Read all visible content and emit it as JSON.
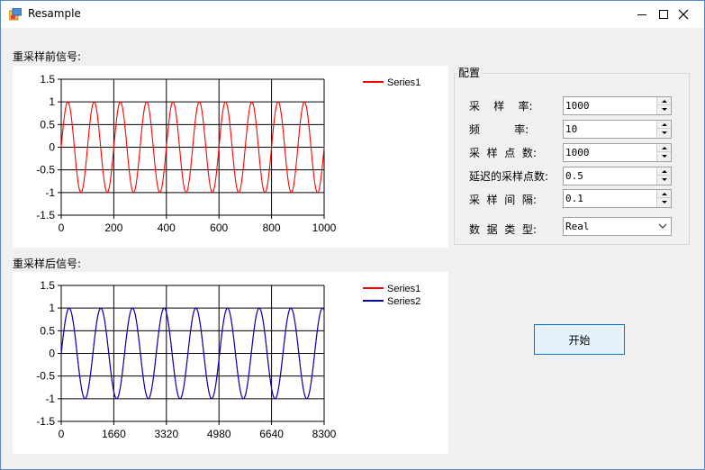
{
  "window": {
    "title": "Resample"
  },
  "titlebar_buttons": {
    "minimize": "minimize-icon",
    "maximize": "maximize-icon",
    "close": "close-icon"
  },
  "labels": {
    "before": "重采样前信号:",
    "after": "重采样后信号:"
  },
  "config": {
    "group_title": "配置",
    "fields": [
      {
        "label": "采    样    率:",
        "value": "1000"
      },
      {
        "label": "频          率:",
        "value": "10"
      },
      {
        "label": "采  样  点  数:",
        "value": "1000"
      },
      {
        "label": "延迟的采样点数:",
        "value": "0.5"
      },
      {
        "label": "采  样  间  隔:",
        "value": "0.1"
      }
    ],
    "data_type_label": "数  据  类  型:",
    "data_type_value": "Real"
  },
  "start_button": {
    "label": "开始"
  },
  "colors": {
    "series1": "#ff0000",
    "series2": "#0000cd",
    "grid": "#000000"
  },
  "chart_data": [
    {
      "type": "line",
      "title": "",
      "xlabel": "",
      "ylabel": "",
      "xlim": [
        0,
        1000
      ],
      "ylim": [
        -1.5,
        1.5
      ],
      "xticks": [
        "0",
        "200",
        "400",
        "600",
        "800",
        "1000"
      ],
      "yticks": [
        "1.5",
        "1",
        "0.5",
        "0",
        "-0.5",
        "-1",
        "-1.5"
      ],
      "grid": true,
      "legend": "top-right",
      "series": [
        {
          "name": "Series1",
          "color": "#ff0000",
          "function": "sin",
          "frequency_cycles": 10,
          "amplitude": 1,
          "points": 1000
        }
      ]
    },
    {
      "type": "line",
      "title": "",
      "xlabel": "",
      "ylabel": "",
      "xlim": [
        0,
        8300
      ],
      "ylim": [
        -1.5,
        1.5
      ],
      "xticks": [
        "0",
        "1660",
        "3320",
        "4980",
        "6640",
        "8300"
      ],
      "yticks": [
        "1.5",
        "1",
        "0.5",
        "0",
        "-0.5",
        "-1",
        "-1.5"
      ],
      "grid": true,
      "legend": "top-right",
      "series": [
        {
          "name": "Series1",
          "color": "#ff0000",
          "function": "sin",
          "frequency_cycles": 8.3,
          "amplitude": 1,
          "points": 8300
        },
        {
          "name": "Series2",
          "color": "#0000cd",
          "function": "sin",
          "frequency_cycles": 8.3,
          "amplitude": 1,
          "points": 8300
        }
      ]
    }
  ]
}
